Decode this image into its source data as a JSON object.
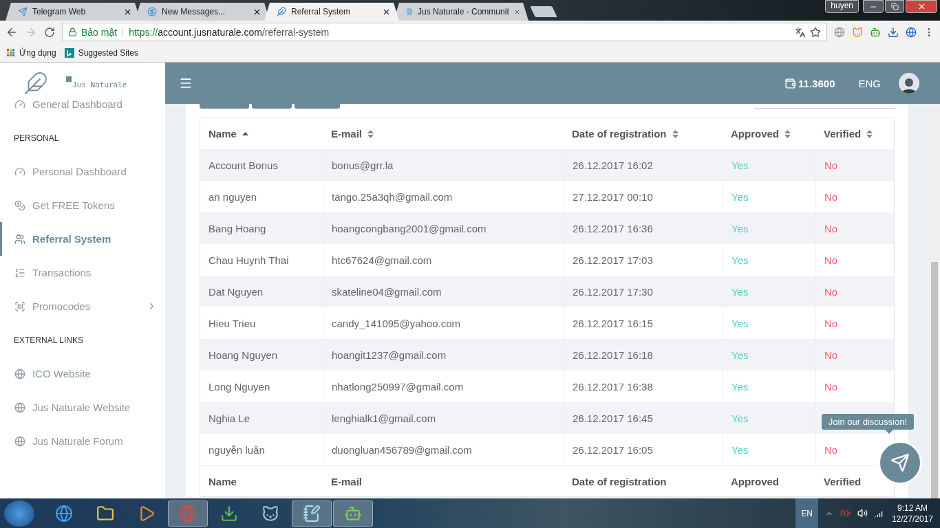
{
  "browser": {
    "tabs": [
      {
        "title": "Telegram Web",
        "selected": false
      },
      {
        "title": "New Messages...",
        "selected": false
      },
      {
        "title": "Referral System",
        "selected": true
      },
      {
        "title": "Jus Naturale - Communit",
        "selected": false
      }
    ],
    "profile": "huyen",
    "address": {
      "security": "Bảo mật",
      "scheme": "https://",
      "host": "account.jusnaturale.com",
      "path": "/referral-system"
    },
    "bookmarks": [
      "Ứng dụng",
      "Suggested Sites"
    ]
  },
  "sidebar": {
    "brand": "Jus Naturale",
    "sections": [
      {
        "items": [
          {
            "label": "General Dashboard",
            "selected": false,
            "expandable": false
          }
        ]
      },
      {
        "heading": "PERSONAL",
        "items": [
          {
            "label": "Personal Dashboard",
            "selected": false,
            "expandable": false
          },
          {
            "label": "Get FREE Tokens",
            "selected": false,
            "expandable": false
          },
          {
            "label": "Referral System",
            "selected": true,
            "expandable": false
          },
          {
            "label": "Transactions",
            "selected": false,
            "expandable": false
          },
          {
            "label": "Promocodes",
            "selected": false,
            "expandable": true
          }
        ]
      },
      {
        "heading": "EXTERNAL LINKS",
        "items": [
          {
            "label": "ICO Website",
            "selected": false,
            "expandable": false
          },
          {
            "label": "Jus Naturale Website",
            "selected": false,
            "expandable": false
          },
          {
            "label": "Jus Naturale Forum",
            "selected": false,
            "expandable": false
          }
        ]
      }
    ]
  },
  "header": {
    "balance": "11.3600",
    "language": "ENG"
  },
  "table": {
    "columns": [
      {
        "label": "Name",
        "sorted": true
      },
      {
        "label": "E-mail",
        "sorted": false
      },
      {
        "label": "Date of registration",
        "sorted": false
      },
      {
        "label": "Approved",
        "sorted": false
      },
      {
        "label": "Verified",
        "sorted": false
      }
    ],
    "rows": [
      {
        "name": "Account Bonus",
        "email": "bonus@grr.la",
        "date": "26.12.2017 16:02",
        "approved": "Yes",
        "verified": "No"
      },
      {
        "name": "an nguyen",
        "email": "tango.25a3qh@gmail.com",
        "date": "27.12.2017 00:10",
        "approved": "Yes",
        "verified": "No"
      },
      {
        "name": "Bang Hoang",
        "email": "hoangcongbang2001@gmail.com",
        "date": "26.12.2017 16:36",
        "approved": "Yes",
        "verified": "No"
      },
      {
        "name": "Chau Huynh Thai",
        "email": "htc67624@gmail.com",
        "date": "26.12.2017 17:03",
        "approved": "Yes",
        "verified": "No"
      },
      {
        "name": "Dat Nguyen",
        "email": "skateline04@gmail.com",
        "date": "26.12.2017 17:30",
        "approved": "Yes",
        "verified": "No"
      },
      {
        "name": "Hieu Trieu",
        "email": "candy_141095@yahoo.com",
        "date": "26.12.2017 16:15",
        "approved": "Yes",
        "verified": "No"
      },
      {
        "name": "Hoang Nguyen",
        "email": "hoangit1237@gmail.com",
        "date": "26.12.2017 16:18",
        "approved": "Yes",
        "verified": "No"
      },
      {
        "name": "Long Nguyen",
        "email": "nhatlong250997@gmail.com",
        "date": "26.12.2017 16:38",
        "approved": "Yes",
        "verified": "No"
      },
      {
        "name": "Nghia Le",
        "email": "lenghialk1@gmail.com",
        "date": "26.12.2017 16:45",
        "approved": "Yes"
      },
      {
        "name": "nguyễn luân",
        "email": "duongluan456789@gmail.com",
        "date": "26.12.2017 16:05",
        "approved": "Yes",
        "verified": "No"
      }
    ],
    "footer": [
      "Name",
      "E-mail",
      "Date of registration",
      "Approved",
      "Verified"
    ]
  },
  "chat": {
    "tooltip": "Join our discussion!"
  },
  "taskbar": {
    "apps": [
      {
        "active": false
      },
      {
        "active": false
      },
      {
        "active": false
      },
      {
        "active": true
      },
      {
        "active": false
      },
      {
        "active": false
      },
      {
        "active": true
      },
      {
        "active": true
      }
    ],
    "language": "EN",
    "time": "9:12 AM",
    "date": "12/27/2017"
  }
}
